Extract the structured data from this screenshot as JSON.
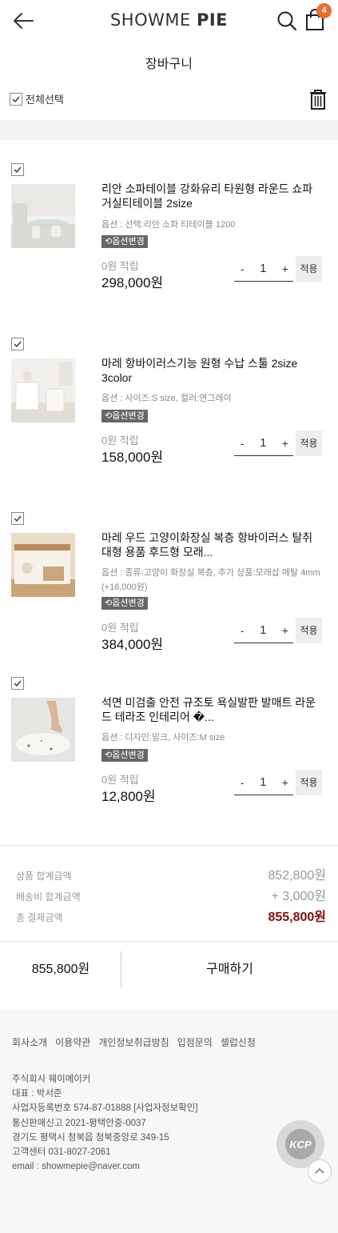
{
  "header": {
    "logo_main": "SHOWME ",
    "logo_accent": "PIE",
    "cart_count": "4",
    "badge_color": "#ef6a2c"
  },
  "page": {
    "title": "장바구니"
  },
  "toolbar": {
    "select_all_label": "전체선택"
  },
  "items": [
    {
      "name": "리안 소파테이블 강화유리 타원형 라운드 쇼파 거실티테이블 2size",
      "option": "옵션 : 선택:리안 소파 티테이블 1200",
      "option_change_label": "옵션변경",
      "points": "0원 적립",
      "price": "298,000원",
      "qty": "1",
      "minus": "-",
      "plus": "+",
      "apply_label": "적용"
    },
    {
      "name": "마레 항바이러스기능 원형 수납 스툴 2size 3color",
      "option": "옵션 : 사이즈:S size, 컬러:연그레이",
      "option_change_label": "옵션변경",
      "points": "0원 적립",
      "price": "158,000원",
      "qty": "1",
      "minus": "-",
      "plus": "+",
      "apply_label": "적용"
    },
    {
      "name": "마레 우드 고양이화장실 복층 항바이러스 탈취 대형 용품 후드형 모래...",
      "option": "옵션 : 종류:고양이 화장실 복층, 추가 상품:모래삽 메탈 4mm (+16,000원)",
      "option_change_label": "옵션변경",
      "points": "0원 적립",
      "price": "384,000원",
      "qty": "1",
      "minus": "-",
      "plus": "+",
      "apply_label": "적용"
    },
    {
      "name": "석면 미검출 안전 규조토 욕실발판 발매트 라운드 테라조 인테리어 �...",
      "option": "옵션 : 디자인:밀크, 사이즈:M size",
      "option_change_label": "옵션변경",
      "points": "0원 적립",
      "price": "12,800원",
      "qty": "1",
      "minus": "-",
      "plus": "+",
      "apply_label": "적용"
    }
  ],
  "summary": {
    "products_label": "상품 합계금액",
    "products_value": "852,800원",
    "shipping_label": "배송비 합계금액",
    "shipping_value": "+ 3,000원",
    "total_label": "총 결제금액",
    "total_value": "855,800원",
    "total_color": "#8a0d0d"
  },
  "buy_bar": {
    "total": "855,800원",
    "buy_label": "구매하기"
  },
  "footer": {
    "links": [
      "회사소개",
      "이용약관",
      "개인정보취급방침",
      "입점문의",
      "셀럽신청"
    ],
    "company": "주식회사 웨이메이커",
    "ceo": "대표 : 박서준",
    "biz_no": "사업자등록번호 574-87-01888 [사업자정보확인]",
    "mail_order": "통신판매신고 2021-평택안중-0037",
    "address": "경기도 평택시 청북읍 청북중앙로 349-15",
    "cs": "고객센터 031-8027-2061",
    "email": "email : showmepie@naver.com",
    "kcp_label": "KCP"
  }
}
